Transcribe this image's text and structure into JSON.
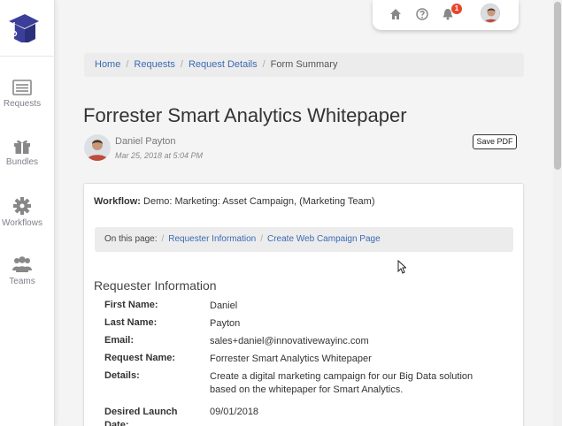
{
  "sidebar": {
    "items": [
      {
        "label": "Requests",
        "icon": "requests-icon"
      },
      {
        "label": "Bundles",
        "icon": "gift-icon"
      },
      {
        "label": "Workflows",
        "icon": "gear-icon"
      },
      {
        "label": "Teams",
        "icon": "team-icon"
      }
    ]
  },
  "topbar": {
    "notification_count": "1"
  },
  "breadcrumb": {
    "items": [
      "Home",
      "Requests",
      "Request Details"
    ],
    "current": "Form Summary"
  },
  "page": {
    "title": "Forrester Smart Analytics Whitepaper",
    "author": "Daniel Payton",
    "date": "Mar 25, 2018 at 5:04 PM",
    "save_pdf": "Save PDF"
  },
  "workflow": {
    "label": "Workflow:",
    "value": "Demo: Marketing: Asset Campaign, (Marketing Team)"
  },
  "on_this_page": {
    "label": "On this page:",
    "links": [
      "Requester Information",
      "Create Web Campaign Page"
    ]
  },
  "requester": {
    "title": "Requester Information",
    "fields": [
      {
        "label": "First Name:",
        "value": "Daniel"
      },
      {
        "label": "Last Name:",
        "value": "Payton"
      },
      {
        "label": "Email:",
        "value": "sales+daniel@innovativewayinc.com"
      },
      {
        "label": "Request Name:",
        "value": "Forrester Smart Analytics Whitepaper"
      },
      {
        "label": "Details:",
        "value": "Create a digital marketing campaign for our Big Data solution based on the whitepaper for Smart Analytics."
      },
      {
        "label": "Desired Launch Date:",
        "value": "09/01/2018"
      }
    ]
  },
  "colors": {
    "link": "#3a6ab4",
    "brand": "#3b3f9a",
    "badge": "#e8452c"
  }
}
